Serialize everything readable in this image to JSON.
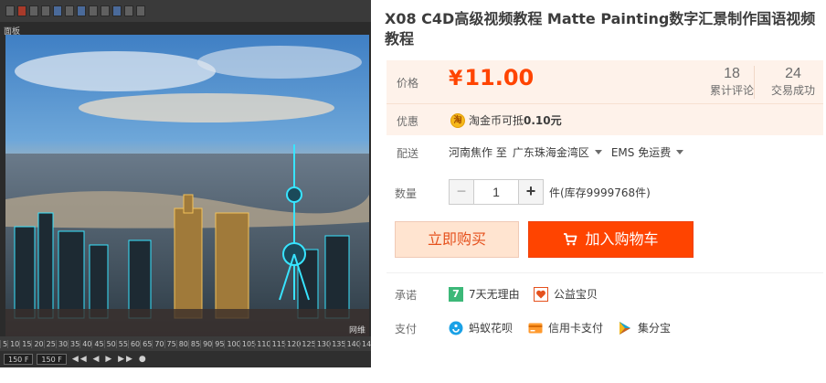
{
  "viewport": {
    "label": "面板",
    "watermark": "网维",
    "timeline_ticks": [
      "5",
      "10",
      "15",
      "20",
      "25",
      "30",
      "35",
      "40",
      "45",
      "50",
      "55",
      "60",
      "65",
      "70",
      "75",
      "80",
      "85",
      "90",
      "95",
      "100",
      "105",
      "110",
      "115",
      "120",
      "125",
      "130",
      "135",
      "140",
      "14"
    ],
    "frame_start": "150 F",
    "frame_current": "150 F"
  },
  "product": {
    "title": "X08 C4D高级视频教程 Matte Painting数字汇景制作国语视频教程"
  },
  "price": {
    "label": "价格",
    "currency": "¥",
    "amount": "11.00",
    "reviews_count": "18",
    "reviews_label": "累计评论",
    "deals_count": "24",
    "deals_label": "交易成功"
  },
  "promo": {
    "label": "优惠",
    "coin_icon_text": "淘",
    "text": "淘金币可抵",
    "value": "0.10元"
  },
  "shipping": {
    "label": "配送",
    "from": "河南焦作 至",
    "to": "广东珠海金湾区",
    "method": "EMS 免运费"
  },
  "quantity": {
    "label": "数量",
    "minus": "−",
    "value": "1",
    "plus": "+",
    "stock": "件(库存9999768件)"
  },
  "actions": {
    "buy_now": "立即购买",
    "add_to_cart": "加入购物车"
  },
  "promise": {
    "label": "承诺",
    "items": [
      {
        "icon": "seven-day-return-icon",
        "text": "7天无理由",
        "icon_text": "7"
      },
      {
        "icon": "charity-icon",
        "text": "公益宝贝"
      }
    ]
  },
  "payment": {
    "label": "支付",
    "items": [
      {
        "icon": "huabei-icon",
        "text": "蚂蚁花呗"
      },
      {
        "icon": "credit-card-icon",
        "text": "信用卡支付"
      },
      {
        "icon": "jifenbao-icon",
        "text": "集分宝"
      }
    ]
  },
  "colors": {
    "accent": "#ff4400",
    "price_panel_bg": "#fef2ea",
    "buy_button_bg": "#ffe4d0"
  }
}
